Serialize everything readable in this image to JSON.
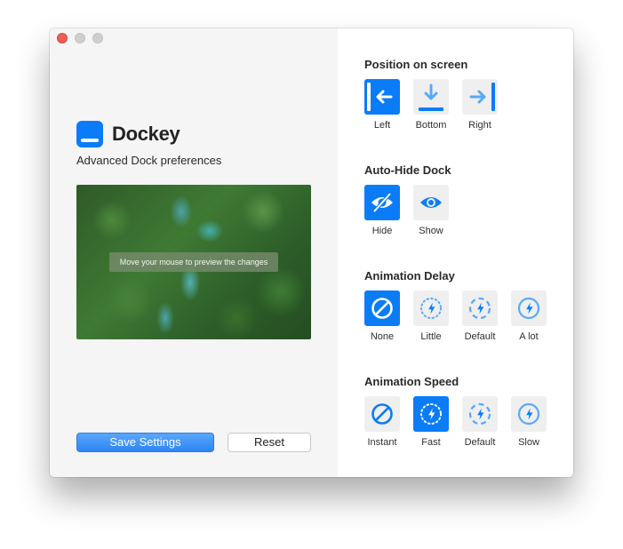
{
  "app": {
    "name": "Dockey",
    "tagline": "Advanced Dock preferences",
    "preview_caption": "Move your mouse to preview the changes"
  },
  "actions": {
    "save_label": "Save Settings",
    "reset_label": "Reset"
  },
  "sections": {
    "position": {
      "title": "Position on screen",
      "options": [
        {
          "label": "Left",
          "icon": "dock-left-icon",
          "selected": true
        },
        {
          "label": "Bottom",
          "icon": "dock-bottom-icon",
          "selected": false
        },
        {
          "label": "Right",
          "icon": "dock-right-icon",
          "selected": false
        }
      ]
    },
    "autohide": {
      "title": "Auto-Hide Dock",
      "options": [
        {
          "label": "Hide",
          "icon": "eye-slash-icon",
          "selected": true
        },
        {
          "label": "Show",
          "icon": "eye-icon",
          "selected": false
        }
      ]
    },
    "delay": {
      "title": "Animation Delay",
      "options": [
        {
          "label": "None",
          "icon": "no-symbol-icon",
          "selected": true
        },
        {
          "label": "Little",
          "icon": "bolt-dotted-icon",
          "selected": false
        },
        {
          "label": "Default",
          "icon": "bolt-dashed-icon",
          "selected": false
        },
        {
          "label": "A lot",
          "icon": "bolt-circle-icon",
          "selected": false
        }
      ]
    },
    "speed": {
      "title": "Animation Speed",
      "options": [
        {
          "label": "Instant",
          "icon": "no-symbol-icon",
          "selected": false
        },
        {
          "label": "Fast",
          "icon": "bolt-dotted-icon",
          "selected": true
        },
        {
          "label": "Default",
          "icon": "bolt-dashed-icon",
          "selected": false
        },
        {
          "label": "Slow",
          "icon": "bolt-circle-icon",
          "selected": false
        }
      ]
    }
  },
  "colors": {
    "accent": "#0a7cf8",
    "accent_light": "#5aa9f8",
    "tile_bg": "#efefef"
  }
}
